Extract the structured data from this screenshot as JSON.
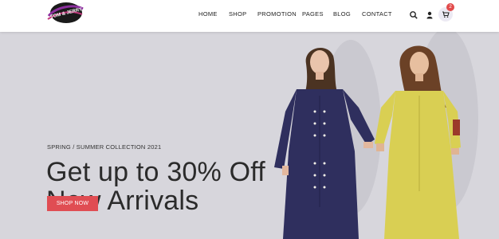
{
  "brand": {
    "logo_text": "TOM & JERRY"
  },
  "nav": {
    "items": [
      {
        "label": "HOME"
      },
      {
        "label": "SHOP"
      },
      {
        "label": "PROMOTION"
      },
      {
        "label": "PAGES"
      },
      {
        "label": "BLOG"
      },
      {
        "label": "CONTACT"
      }
    ]
  },
  "header_icons": {
    "search": "search-icon",
    "user": "user-icon",
    "cart": "cart-icon",
    "cart_count": "2"
  },
  "hero": {
    "subtitle": "SPRING / SUMMER COLLECTION 2021",
    "headline_line1": "Get up to 30% Off",
    "headline_line2": "New Arrivals",
    "cta_label": "SHOP NOW"
  },
  "colors": {
    "accent": "#e04d53",
    "hero_bg": "#d7d6dc",
    "logo_purple": "#7b2a8c"
  }
}
